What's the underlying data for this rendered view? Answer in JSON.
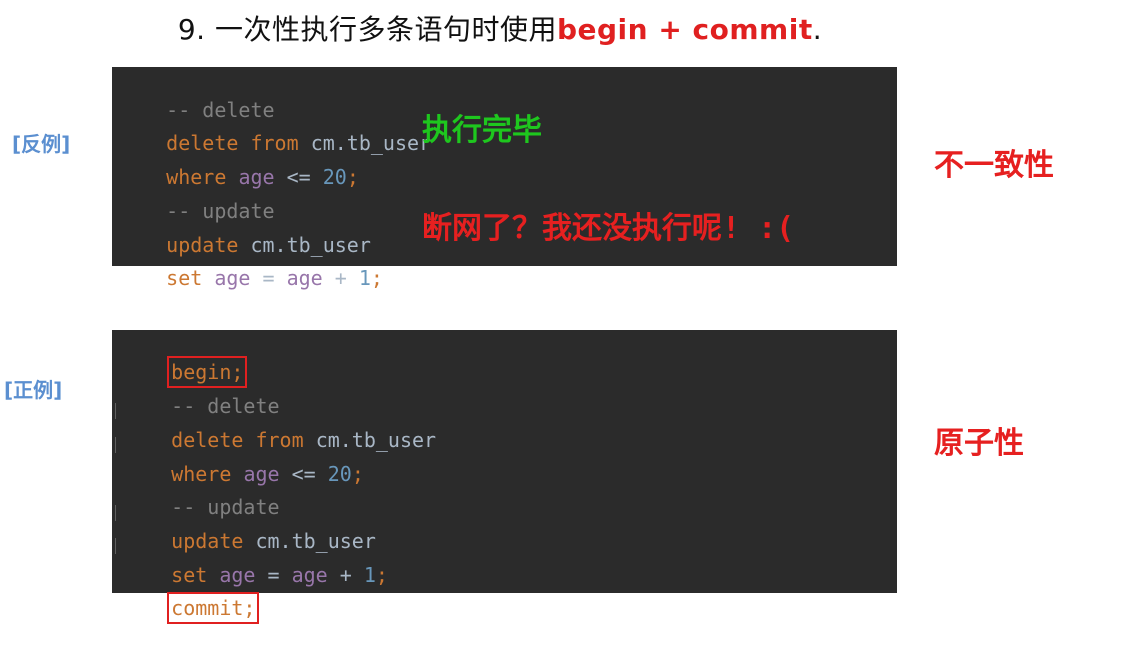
{
  "title": {
    "main": "9. 一次性执行多条语句时使用",
    "highlight": "begin + commit",
    "tail": "."
  },
  "bad": {
    "label": "[反例]",
    "lines": {
      "l1": {
        "comment": "-- delete"
      },
      "l2": {
        "kw": "delete",
        "kw2": "from",
        "tbl": "cm.tb_user"
      },
      "l3": {
        "kw": "where",
        "col": "age",
        "op": " <= ",
        "num": "20",
        "punct": ";"
      },
      "l4": {
        "comment": "-- update"
      },
      "l5": {
        "kw": "update",
        "tbl": "cm.tb_user"
      },
      "l6": {
        "kw": "set",
        "col": "age",
        "op": " = ",
        "col2": "age",
        "op2": " + ",
        "num": "1",
        "punct": ";"
      }
    },
    "note_done": "执行完毕",
    "note_fail": "断网了？我还没执行呢! :(",
    "property": "不一致性"
  },
  "good": {
    "label": "[正例]",
    "lines": {
      "l0": {
        "kw": "begin",
        "punct": ";"
      },
      "l1": {
        "comment": "-- delete"
      },
      "l2": {
        "kw": "delete",
        "kw2": "from",
        "tbl": "cm.tb_user"
      },
      "l3": {
        "kw": "where",
        "col": "age",
        "op": " <= ",
        "num": "20",
        "punct": ";"
      },
      "l4": {
        "comment": "-- update"
      },
      "l5": {
        "kw": "update",
        "tbl": "cm.tb_user"
      },
      "l6": {
        "kw": "set",
        "col": "age",
        "op": " = ",
        "col2": "age",
        "op2": " + ",
        "num": "1",
        "punct": ";"
      },
      "l7": {
        "kw": "commit",
        "punct": ";"
      }
    },
    "property": "原子性"
  },
  "colors": {
    "keyword": "#cc7832",
    "column": "#9876aa",
    "number": "#6897bb",
    "comment": "#808080",
    "editor_bg": "#2b2b2b",
    "highlight_red": "#e02020",
    "note_green": "#1ec71e",
    "label_blue": "#5b8fd0"
  }
}
